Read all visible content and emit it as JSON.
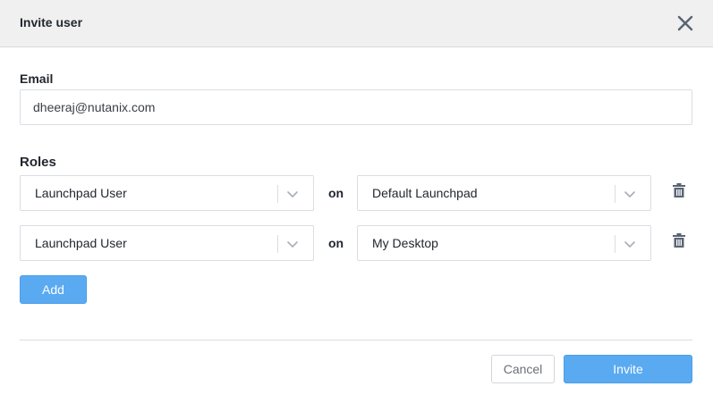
{
  "dialog": {
    "title": "Invite user",
    "close_icon": "close-icon"
  },
  "email": {
    "label": "Email",
    "value": "dheeraj@nutanix.com",
    "placeholder": ""
  },
  "roles": {
    "label": "Roles",
    "connector": "on",
    "rows": [
      {
        "role": "Launchpad User",
        "target": "Default Launchpad"
      },
      {
        "role": "Launchpad User",
        "target": "My Desktop"
      }
    ]
  },
  "actions": {
    "add_label": "Add",
    "cancel_label": "Cancel",
    "invite_label": "Invite"
  },
  "colors": {
    "primary": "#5aaaf2",
    "header_bg": "#f0f0f0",
    "icon": "#5a6573"
  }
}
